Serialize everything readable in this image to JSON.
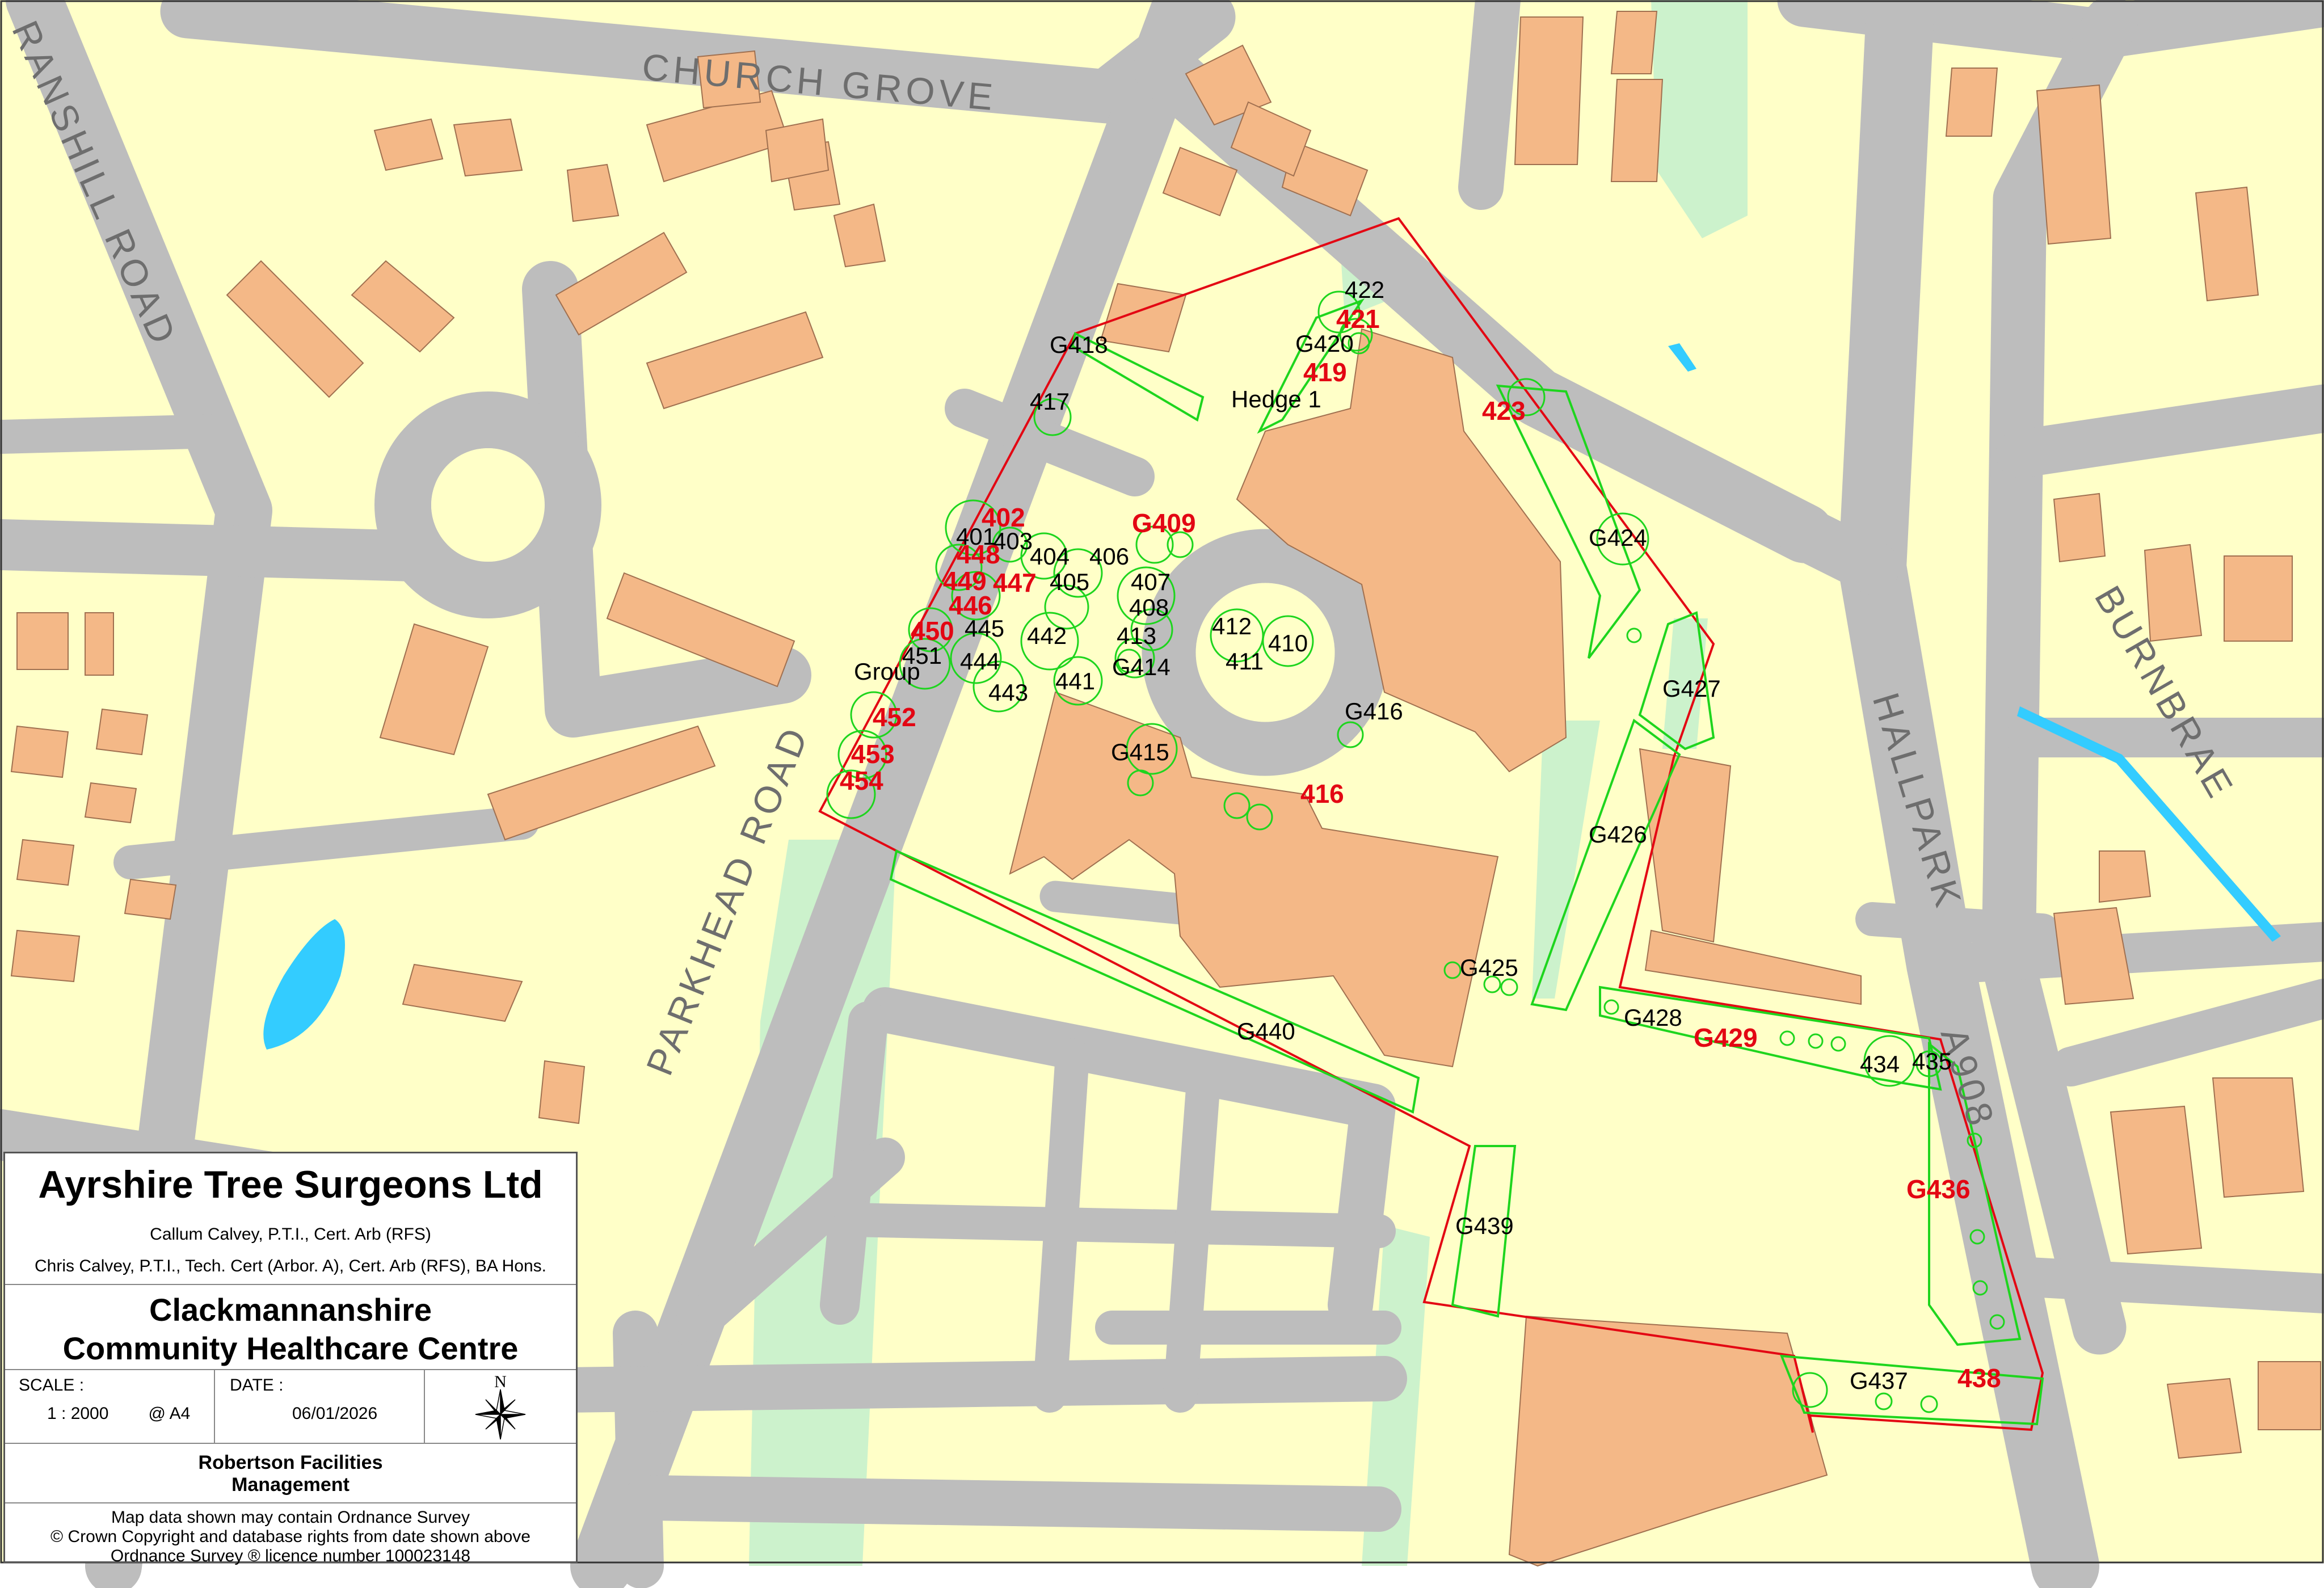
{
  "streets": [
    "CHURCH GROVE",
    "RANSHILL ROAD",
    "PARKHEAD ROAD",
    "HALLPARK",
    "A908",
    "BURNBRAE"
  ],
  "tree_labels_black": [
    "422",
    "G420",
    "G418",
    "Hedge 1",
    "417",
    "401",
    "403",
    "404",
    "406",
    "405",
    "407",
    "408",
    "413",
    "412",
    "410",
    "411",
    "G414",
    "442",
    "441",
    "445",
    "444",
    "443",
    "451",
    "Group",
    "G424",
    "G427",
    "G416",
    "G415",
    "G426",
    "G425",
    "G428",
    "434",
    "435",
    "G440",
    "G439",
    "G437"
  ],
  "tree_labels_red": [
    "421",
    "419",
    "423",
    "402",
    "448",
    "449",
    "447",
    "446",
    "450",
    "G409",
    "452",
    "453",
    "454",
    "416",
    "G429",
    "G436",
    "438"
  ],
  "title_block": {
    "company": "Ayrshire Tree Surgeons Ltd",
    "person1": "Callum Calvey, P.T.I., Cert. Arb (RFS)",
    "person2": "Chris Calvey, P.T.I., Tech. Cert (Arbor. A), Cert. Arb (RFS), BA Hons.",
    "project_line1": "Clackmannanshire",
    "project_line2": "Community Healthcare Centre",
    "scale_label": "SCALE :",
    "scale_value": "1 : 2000",
    "paper": "@ A4",
    "date_label": "DATE :",
    "date_value": "06/01/2026",
    "north": "N",
    "client_line1": "Robertson Facilities",
    "client_line2": "Management",
    "copyright1": "Map data shown may contain Ordnance Survey",
    "copyright2": "© Crown Copyright and database rights from date shown above",
    "copyright3": "Ordnance Survey ® licence number 100023148"
  },
  "colors": {
    "land": "#ffffc8",
    "road": "#bdbdbd",
    "building": "#f4b887",
    "green": "#ccf2cc",
    "water": "#33ccff",
    "site_boundary": "#e30613",
    "tree_outline": "#1ed51e"
  }
}
